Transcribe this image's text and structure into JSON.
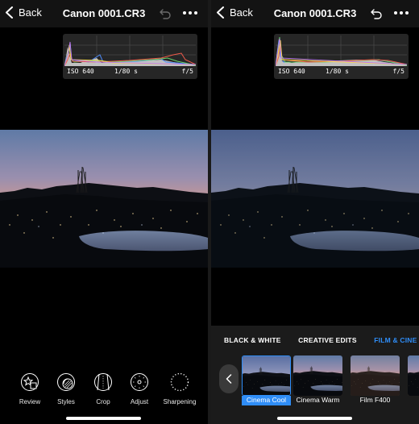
{
  "left_screen": {
    "back_label": "Back",
    "title": "Canon 0001.CR3",
    "histogram": {
      "iso": "ISO 640",
      "shutter": "1/80 s",
      "aperture": "f/5"
    },
    "toolbar": [
      {
        "label": "Review",
        "icon": "review-star-icon"
      },
      {
        "label": "Styles",
        "icon": "styles-circles-icon"
      },
      {
        "label": "Crop",
        "icon": "crop-icon"
      },
      {
        "label": "Adjust",
        "icon": "adjust-dial-icon"
      },
      {
        "label": "Sharpening",
        "icon": "sharpening-icon"
      }
    ]
  },
  "right_screen": {
    "back_label": "Back",
    "title": "Canon 0001.CR3",
    "histogram": {
      "iso": "ISO 640",
      "shutter": "1/80 s",
      "aperture": "f/5"
    },
    "style_categories": [
      "BLACK & WHITE",
      "CREATIVE EDITS",
      "FILM & CINE LOOKS"
    ],
    "active_category": "FILM & CINE LOOKS",
    "style_thumbnails": [
      {
        "label": "Cinema Cool",
        "selected": true
      },
      {
        "label": "Cinema Warm",
        "selected": false
      },
      {
        "label": "Film F400",
        "selected": false
      },
      {
        "label": "",
        "selected": false
      }
    ]
  },
  "colors": {
    "accent": "#2f8df7",
    "topbar": "#131313",
    "styles_panel": "#1b1b1b"
  }
}
